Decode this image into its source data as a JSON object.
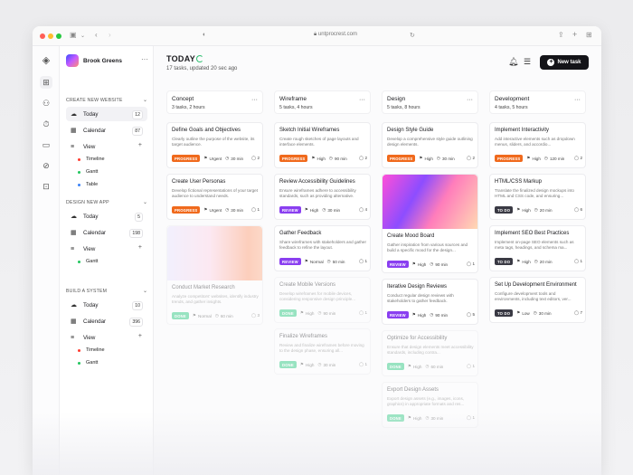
{
  "browser": {
    "url": "untprocrest.com"
  },
  "workspace": {
    "name": "Brook Greens"
  },
  "sidebar": {
    "sections": [
      {
        "title": "CREATE NEW WEBSITE",
        "items": [
          {
            "label": "Today",
            "count": "12",
            "icon": "cloud-sun-icon"
          },
          {
            "label": "Calendar",
            "count": "87",
            "icon": "calendar-icon"
          },
          {
            "label": "View",
            "icon": "view-icon"
          }
        ],
        "views": [
          {
            "label": "Timeline",
            "color": "#ff3b30"
          },
          {
            "label": "Gantt",
            "color": "#22c55e"
          },
          {
            "label": "Table",
            "color": "#3b82f6"
          }
        ]
      },
      {
        "title": "DESIGN NEW APP",
        "items": [
          {
            "label": "Today",
            "count": "5",
            "icon": "cloud-sun-icon"
          },
          {
            "label": "Calendar",
            "count": "198",
            "icon": "calendar-icon"
          },
          {
            "label": "View",
            "icon": "view-icon"
          }
        ],
        "views": [
          {
            "label": "Gantt",
            "color": "#22c55e"
          }
        ]
      },
      {
        "title": "BUILD A SYSTEM",
        "items": [
          {
            "label": "Today",
            "count": "10",
            "icon": "cloud-sun-icon"
          },
          {
            "label": "Calendar",
            "count": "396",
            "icon": "calendar-icon"
          },
          {
            "label": "View",
            "icon": "view-icon"
          }
        ],
        "views": [
          {
            "label": "Timeline",
            "color": "#ff3b30"
          },
          {
            "label": "Gantt",
            "color": "#22c55e"
          }
        ]
      }
    ]
  },
  "header": {
    "title": "TODAY",
    "subtitle": "17 tasks, updated 20 sec ago",
    "new_task": "New task"
  },
  "columns": [
    {
      "name": "Concept",
      "meta": "3 tasks, 2 hours",
      "cards": [
        {
          "title": "Define Goals and Objectives",
          "desc": "Clearly outline the purpose of the website, its target audience.",
          "badge": "PROGRESS",
          "priority": "Urgent",
          "time": "30 min",
          "comments": "2"
        },
        {
          "title": "Create User Personas",
          "desc": "Develop fictional representations of your target audience to understand needs.",
          "badge": "PROGRESS",
          "priority": "Urgent",
          "time": "30 min",
          "comments": "1"
        },
        {
          "title": "Conduct Market Research",
          "desc": "Analyze competitors' websites, identify industry trends, and gather insights.",
          "badge": "DONE",
          "priority": "Normal",
          "time": "60 min",
          "comments": "3",
          "image": "peach",
          "faded": true
        }
      ]
    },
    {
      "name": "Wireframe",
      "meta": "5 tasks, 4 hours",
      "cards": [
        {
          "title": "Sketch Initial Wireframes",
          "desc": "Create rough sketches of page layouts and interface elements.",
          "badge": "PROGRESS",
          "priority": "High",
          "time": "90 min",
          "comments": "2"
        },
        {
          "title": "Review Accessibility Guidelines",
          "desc": "Ensure wireframes adhere to accessibility standards, such as providing alternative.",
          "badge": "REVIEW",
          "priority": "High",
          "time": "30 min",
          "comments": "4"
        },
        {
          "title": "Gather Feedback",
          "desc": "Share wireframes with stakeholders and gather feedback to refine the layout.",
          "badge": "REVIEW",
          "priority": "Normal",
          "time": "50 min",
          "comments": "1"
        },
        {
          "title": "Create Mobile Versions",
          "desc": "Develop wireframes for mobile devices, considering responsive design principle...",
          "badge": "DONE",
          "priority": "High",
          "time": "90 min",
          "comments": "1",
          "faded": true
        },
        {
          "title": "Finalize Wireframes",
          "desc": "Review and finalize wireframes before moving to the design phase, ensuring all...",
          "badge": "DONE",
          "priority": "High",
          "time": "30 min",
          "comments": "1",
          "faded": true
        }
      ]
    },
    {
      "name": "Design",
      "meta": "5 tasks, 8 hours",
      "cards": [
        {
          "title": "Design Style Guide",
          "desc": "Develop a comprehensive style guide outlining design elements.",
          "badge": "PROGRESS",
          "priority": "High",
          "time": "30 min",
          "comments": "2"
        },
        {
          "title": "Create Mood Board",
          "desc": "Gather inspiration from various sources and build a specific mood for the design...",
          "badge": "REVIEW",
          "priority": "High",
          "time": "90 min",
          "comments": "1",
          "image": "rainbow"
        },
        {
          "title": "Iterative Design Reviews",
          "desc": "Conduct regular design reviews with stakeholders to gather feedback.",
          "badge": "REVIEW",
          "priority": "High",
          "time": "90 min",
          "comments": "5"
        },
        {
          "title": "Optimize for Accessibility",
          "desc": "Ensure that design elements meet accessibility standards, including contra...",
          "badge": "DONE",
          "priority": "High",
          "time": "60 min",
          "comments": "1",
          "faded": true
        },
        {
          "title": "Export Design Assets",
          "desc": "Export design assets (e.g., images, icons, graphics) in appropriate formats and res...",
          "badge": "DONE",
          "priority": "High",
          "time": "30 min",
          "comments": "1",
          "faded": true
        }
      ]
    },
    {
      "name": "Development",
      "meta": "4 tasks, 5 hours",
      "cards": [
        {
          "title": "Implement Interactivity",
          "desc": "Add interactive elements such as dropdown menus, sliders, and accordio...",
          "badge": "PROGRESS",
          "priority": "High",
          "time": "120 min",
          "comments": "2"
        },
        {
          "title": "HTML/CSS Markup",
          "desc": "Translate the finalized design mockups into HTML and CSS code, and ensuring...",
          "badge": "TO DO",
          "priority": "High",
          "time": "20 min",
          "comments": "6"
        },
        {
          "title": "Implement SEO Best Practices",
          "desc": "Implement on-page SEO elements such as meta tags, headings, and schema ma...",
          "badge": "TO DO",
          "priority": "High",
          "time": "20 min",
          "comments": "1"
        },
        {
          "title": "Set Up Development Environment",
          "desc": "Configure development tools and environments, including text editors, ver...",
          "badge": "TO DO",
          "priority": "Low",
          "time": "30 min",
          "comments": "7"
        }
      ]
    }
  ]
}
